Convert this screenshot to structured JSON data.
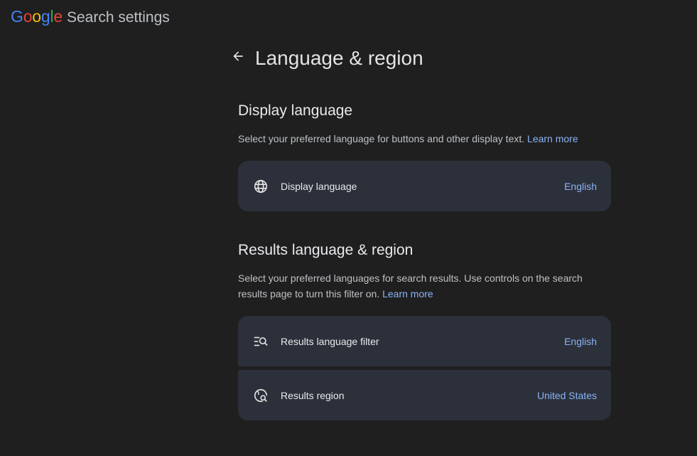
{
  "header": {
    "logo_letters": [
      "G",
      "o",
      "o",
      "g",
      "l",
      "e"
    ],
    "logo_colors": [
      "#4285f4",
      "#ea4335",
      "#fbbc05",
      "#4285f4",
      "#34a853",
      "#ea4335"
    ],
    "app_title": "Search settings"
  },
  "page": {
    "title": "Language & region"
  },
  "display_language": {
    "heading": "Display language",
    "description": "Select your preferred language for buttons and other display text.",
    "learn_more": "Learn more",
    "row": {
      "label": "Display language",
      "value": "English",
      "icon": "globe-icon"
    }
  },
  "results": {
    "heading": "Results language & region",
    "description": "Select your preferred languages for search results. Use controls on the search results page to turn this filter on.",
    "learn_more": "Learn more",
    "rows": [
      {
        "label": "Results language filter",
        "value": "English",
        "icon": "filter-search-icon"
      },
      {
        "label": "Results region",
        "value": "United States",
        "icon": "globe-search-icon"
      }
    ]
  },
  "colors": {
    "background": "#1f1f1f",
    "card": "#2c303a",
    "link": "#8ab4f8"
  }
}
